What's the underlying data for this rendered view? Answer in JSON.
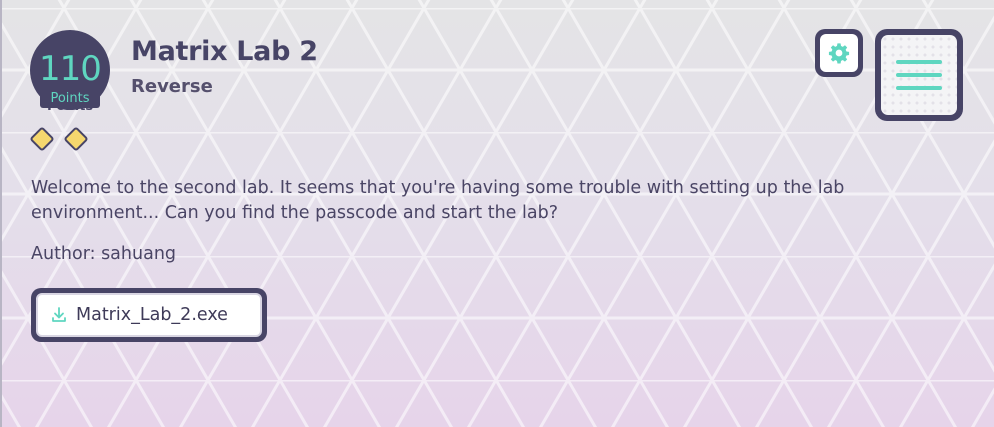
{
  "challenge": {
    "points_value": "110",
    "points_label": "Points",
    "title": "Matrix Lab 2",
    "category": "Reverse",
    "difficulty_level": 2,
    "description": "Welcome to the second lab. It seems that you're having some trouble with setting up the lab environment... Can you find the passcode and start the lab?",
    "author": "Author: sahuang",
    "file_name": "Matrix_Lab_2.exe"
  },
  "icons": {
    "settings": "gear-icon",
    "menu": "hamburger-menu-icon",
    "download": "download-icon",
    "difficulty": "diamond-icon"
  },
  "colors": {
    "accent": "#5fd6c0",
    "dark": "#474466",
    "diamond": "#f5d76e"
  }
}
